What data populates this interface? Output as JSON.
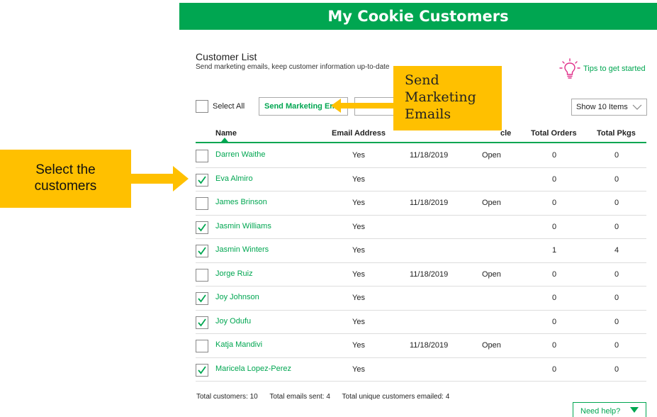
{
  "header": {
    "title": "My Cookie Customers"
  },
  "list": {
    "title": "Customer List",
    "subtitle": "Send marketing emails, keep customer information up-to-date"
  },
  "tips": {
    "label": "Tips to get started",
    "icon": "lightbulb-icon"
  },
  "toolbar": {
    "select_all_label": "Select All",
    "send_button_label": "Send Marketing Emails",
    "show_items": "Show 10 Items"
  },
  "callouts": {
    "send": [
      "Send",
      "Marketing",
      "Emails"
    ],
    "select": [
      "Select the",
      "customers"
    ]
  },
  "table": {
    "columns": [
      "Name",
      "Email Address",
      "",
      "cle",
      "Total Orders",
      "Total Pkgs"
    ],
    "rows": [
      {
        "checked": false,
        "name": "Darren Waithe",
        "email": "Yes",
        "date": "11/18/2019",
        "status": "Open",
        "orders": "0",
        "pkgs": "0"
      },
      {
        "checked": true,
        "name": "Eva Almiro",
        "email": "Yes",
        "date": "",
        "status": "",
        "orders": "0",
        "pkgs": "0"
      },
      {
        "checked": false,
        "name": "James Brinson",
        "email": "Yes",
        "date": "11/18/2019",
        "status": "Open",
        "orders": "0",
        "pkgs": "0"
      },
      {
        "checked": true,
        "name": "Jasmin Williams",
        "email": "Yes",
        "date": "",
        "status": "",
        "orders": "0",
        "pkgs": "0"
      },
      {
        "checked": true,
        "name": "Jasmin Winters",
        "email": "Yes",
        "date": "",
        "status": "",
        "orders": "1",
        "pkgs": "4"
      },
      {
        "checked": false,
        "name": "Jorge Ruiz",
        "email": "Yes",
        "date": "11/18/2019",
        "status": "Open",
        "orders": "0",
        "pkgs": "0"
      },
      {
        "checked": true,
        "name": "Joy Johnson",
        "email": "Yes",
        "date": "",
        "status": "",
        "orders": "0",
        "pkgs": "0"
      },
      {
        "checked": true,
        "name": "Joy Odufu",
        "email": "Yes",
        "date": "",
        "status": "",
        "orders": "0",
        "pkgs": "0"
      },
      {
        "checked": false,
        "name": "Katja Mandivi",
        "email": "Yes",
        "date": "11/18/2019",
        "status": "Open",
        "orders": "0",
        "pkgs": "0"
      },
      {
        "checked": true,
        "name": "Maricela Lopez-Perez",
        "email": "Yes",
        "date": "",
        "status": "",
        "orders": "0",
        "pkgs": "0"
      }
    ]
  },
  "totals": {
    "customers": "Total customers: 10",
    "emails_sent": "Total emails sent: 4",
    "unique_emailed": "Total unique customers emailed: 4"
  },
  "help": {
    "label": "Need help?"
  },
  "colors": {
    "brand_green": "#00a651",
    "callout": "#ffc000",
    "icon_pink": "#e0308a"
  }
}
